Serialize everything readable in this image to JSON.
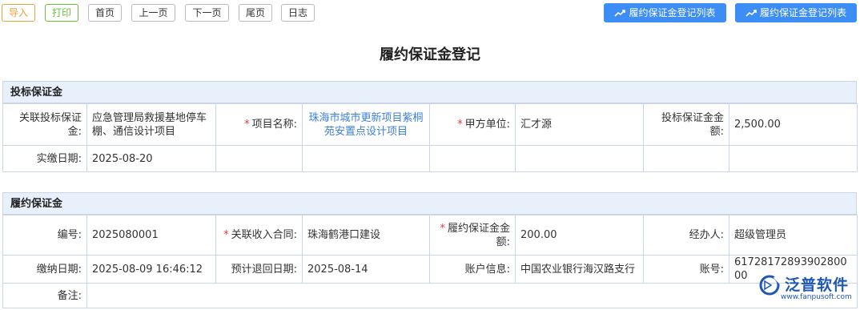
{
  "toolbar": {
    "import": "导入",
    "print": "打印",
    "first": "首页",
    "prev": "上一页",
    "next": "下一页",
    "last": "尾页",
    "log": "日志",
    "list1": "履约保证金登记列表",
    "list2": "履约保证金登记列表"
  },
  "title": "履约保证金登记",
  "bid": {
    "heading": "投标保证金",
    "contract_label": "关联投标保证金:",
    "contract_value": "应急管理局救援基地停车棚、通信设计项目",
    "project_label": "项目名称:",
    "project_value": "珠海市城市更新项目紫桐苑安置点设计项目",
    "party_label": "甲方单位:",
    "party_value": "汇才源",
    "amount_label": "投标保证金金额:",
    "amount_value": "2,500.00",
    "paid_date_label": "实缴日期:",
    "paid_date_value": "2025-08-20"
  },
  "perf": {
    "heading": "履约保证金",
    "code_label": "编号:",
    "code_value": "2025080001",
    "income_label": "关联收入合同:",
    "income_value": "珠海鹤港口建设",
    "amount_label": "履约保证金金额:",
    "amount_value": "200.00",
    "handler_label": "经办人:",
    "handler_value": "超级管理员",
    "pay_date_label": "缴纳日期:",
    "pay_date_value": "2025-08-09 16:46:12",
    "return_label": "预计退回日期:",
    "return_value": "2025-08-14",
    "account_info_label": "账户信息:",
    "account_info_value": "中国农业银行海汉路支行",
    "account_label": "账号:",
    "account_value": "6172817289390280000",
    "remark_label": "备注:",
    "remark_value": ""
  },
  "logo": {
    "name": "泛普软件",
    "url": "www.fanpusoft.com"
  },
  "colors": {
    "primary": "#3c8ef6",
    "import": "#e6a23c",
    "print": "#67c23a",
    "required": "#e53935",
    "link": "#3c7fd8",
    "section_bg": "#e8f0fb",
    "logo": "#1e57b5"
  },
  "icons": {
    "list_button": "trend-up-icon",
    "logo": "fanpu-logo-icon"
  }
}
